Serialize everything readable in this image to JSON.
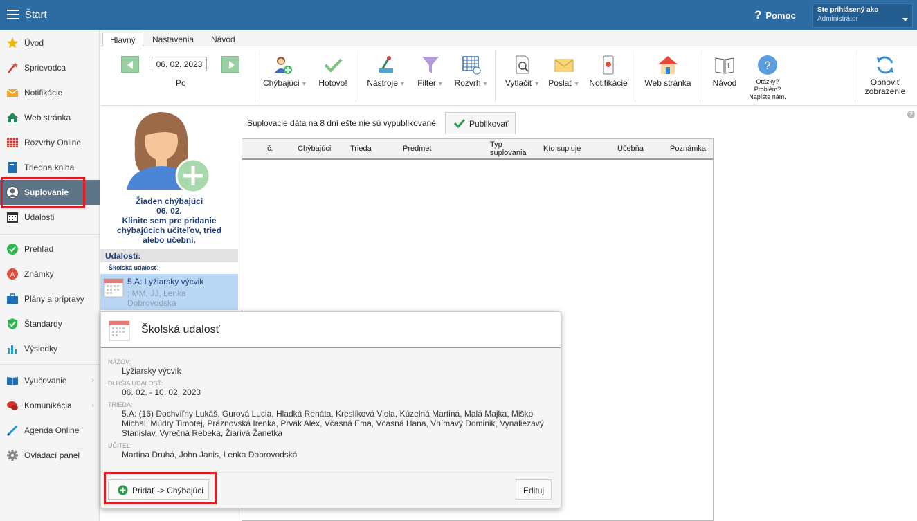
{
  "topbar": {
    "title": "Štart",
    "help": "Pomoc",
    "user_line1": "Ste prihlásený ako",
    "user_line2": "Administrátor"
  },
  "sidebar": {
    "items": [
      {
        "label": "Úvod",
        "icon": "star-icon"
      },
      {
        "label": "Sprievodca",
        "icon": "wand-icon"
      },
      {
        "label": "Notifikácie",
        "icon": "envelope-icon"
      },
      {
        "label": "Web stránka",
        "icon": "home-icon"
      },
      {
        "label": "Rozvrhy Online",
        "icon": "timetable-icon"
      },
      {
        "label": "Triedna kniha",
        "icon": "book-icon"
      },
      {
        "label": "Suplovanie",
        "icon": "person-icon"
      },
      {
        "label": "Udalosti",
        "icon": "calendar-icon"
      },
      {
        "label": "Prehľad",
        "icon": "check-circle-icon"
      },
      {
        "label": "Známky",
        "icon": "grade-icon"
      },
      {
        "label": "Plány a prípravy",
        "icon": "briefcase-icon"
      },
      {
        "label": "Štandardy",
        "icon": "shield-check-icon"
      },
      {
        "label": "Výsledky",
        "icon": "bar-chart-icon"
      },
      {
        "label": "Vyučovanie",
        "icon": "open-book-icon"
      },
      {
        "label": "Komunikácia",
        "icon": "chat-icon"
      },
      {
        "label": "Agenda Online",
        "icon": "pen-icon"
      },
      {
        "label": "Ovládací panel",
        "icon": "gear-icon"
      }
    ],
    "active": "Suplovanie"
  },
  "tabs": [
    "Hlavný",
    "Nastavenia",
    "Návod"
  ],
  "ribbon": {
    "date": "06. 02. 2023",
    "day": "Po",
    "chybajuci": "Chýbajúci",
    "hotovo": "Hotovo!",
    "nastroje": "Nástroje",
    "filter": "Filter",
    "rozvrh": "Rozvrh",
    "vytlacit": "Vytlačiť",
    "poslat": "Poslať",
    "notifikacie": "Notifikácie",
    "web": "Web stránka",
    "navod": "Návod",
    "otazky1": "Otázky?",
    "otazky2": "Problém?",
    "otazky3": "Napíšte nám.",
    "obnovit1": "Obnoviť",
    "obnovit2": "zobrazenie"
  },
  "leftpanel": {
    "no_absent_1": "Žiaden chýbajúci",
    "no_absent_2": "06. 02.",
    "no_absent_3": "Klinite sem pre pridanie",
    "no_absent_4": "chýbajúcich učiteľov, tried",
    "no_absent_5": "alebo učební.",
    "udalosti": "Udalosti:",
    "skolska_label": "Školská udalosť:",
    "event_title": "5.A: Lyžiarsky výcvik",
    "event_sub": "; MM, JJ, Lenka Dobrovodská"
  },
  "main": {
    "notice": "Suplovacie dáta na 8 dní ešte nie sú vypublikované.",
    "publish": "Publikovať",
    "columns": [
      "č.",
      "Chýbajúci",
      "Trieda",
      "Predmet",
      "Typ suplovania",
      "Kto supluje",
      "Učebňa",
      "Poznámka"
    ]
  },
  "popup": {
    "title": "Školská udalosť",
    "nazov_label": "NÁZOV:",
    "nazov": "Lyžiarsky výcvik",
    "dlhsia_label": "DLHŠIA UDALOSŤ:",
    "dlhsia": "06. 02. - 10. 02. 2023",
    "trieda_label": "TRIEDA:",
    "trieda": "5.A: (16) Dochvíľny Lukáš, Gurová Lucia, Hladká Renáta, Kreslíková Viola, Kúzelná Martina, Malá Majka, Miško Michal, Múdry Timotej, Práznovská Irenka, Prvák Alex, Včasná Ema, Včasná Hana, Vnímavý Dominik, Vynaliezavý Stanislav, Vyrečná Rebeka, Žiarivá Žanetka",
    "ucitel_label": "UČITEĽ:",
    "ucitel": "Martina Druhá, John Janis, Lenka Dobrovodská",
    "add_button": "Pridať -> Chýbajúci",
    "edit_button": "Edituj"
  },
  "colors": {
    "topbar": "#2d6ca2",
    "sidebar_active": "#5c7486",
    "highlight_box": "#e01b24",
    "event_card": "#b9d7f5"
  }
}
